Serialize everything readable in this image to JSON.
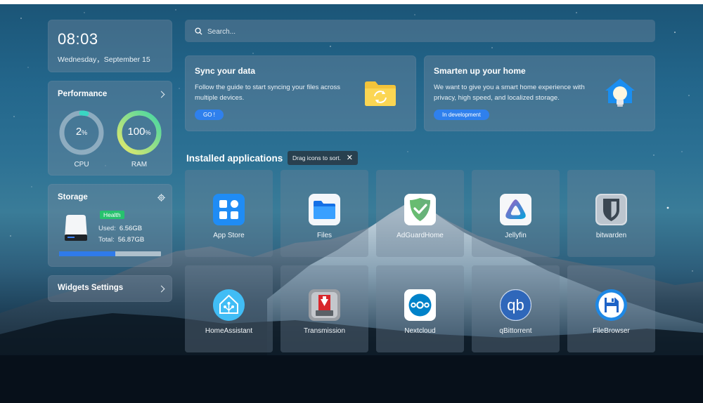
{
  "clock": {
    "time": "08:03",
    "date": "Wednesday，September 15"
  },
  "performance": {
    "title": "Performance",
    "cpu": {
      "value": "2",
      "unit": "%",
      "label": "CPU",
      "percent": 2
    },
    "ram": {
      "value": "100",
      "unit": "%",
      "label": "RAM",
      "percent": 100
    }
  },
  "storage": {
    "title": "Storage",
    "status": "Health",
    "used_label": "Used:",
    "used": "6.56GB",
    "total_label": "Total:",
    "total": "56.87GB",
    "usage_fraction": 0.55
  },
  "widgets_settings": {
    "label": "Widgets Settings"
  },
  "search": {
    "placeholder": "Search..."
  },
  "sync_card": {
    "title": "Sync your data",
    "desc": "Follow the guide to start syncing your files across multiple devices.",
    "button": "GO !"
  },
  "home_card": {
    "title": "Smarten up your home",
    "desc": "We want to give you a smart home experience with privacy, high speed, and localized storage.",
    "button": "In development"
  },
  "apps_section": {
    "title": "Installed applications",
    "tip": "Drag icons to sort.",
    "tip_close": "✕"
  },
  "apps": [
    {
      "name": "App Store",
      "icon": "app-store-icon"
    },
    {
      "name": "Files",
      "icon": "files-icon"
    },
    {
      "name": "AdGuardHome",
      "icon": "adguard-icon"
    },
    {
      "name": "Jellyfin",
      "icon": "jellyfin-icon"
    },
    {
      "name": "bitwarden",
      "icon": "bitwarden-icon"
    },
    {
      "name": "HomeAssistant",
      "icon": "home-assistant-icon"
    },
    {
      "name": "Transmission",
      "icon": "transmission-icon"
    },
    {
      "name": "Nextcloud",
      "icon": "nextcloud-icon"
    },
    {
      "name": "qBittorrent",
      "icon": "qbittorrent-icon"
    },
    {
      "name": "FileBrowser",
      "icon": "filebrowser-icon"
    }
  ],
  "colors": {
    "accent": "#2f80ed",
    "health": "#27c26e",
    "cpu_ring": "#3ad6c3",
    "ram_ring_start": "#e7e96a",
    "ram_ring_end": "#43d6a4"
  }
}
